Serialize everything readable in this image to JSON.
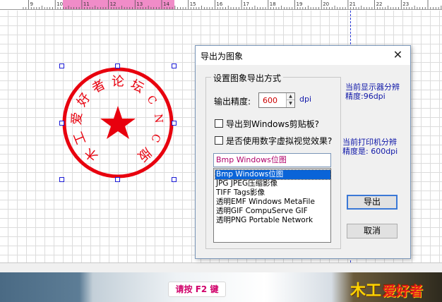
{
  "ruler": {
    "labels": [
      "9",
      "10",
      "11",
      "12",
      "13",
      "14",
      "15",
      "16",
      "17",
      "18",
      "19",
      "20",
      "21",
      "22",
      "23"
    ]
  },
  "seal": {
    "ring_text": "木工爱好者论坛CNC版",
    "color": "#e8000e"
  },
  "dialog": {
    "title": "导出为图象",
    "close_glyph": "✕",
    "group_legend": "设置图象导出方式",
    "precision_label": "输出精度:",
    "precision_value": "600",
    "precision_unit": "dpi",
    "clipboard_label": "导出到Windows剪贴板?",
    "digital_label": "是否使用数字虚拟视觉效果?",
    "format_selected": "Bmp Windows位图",
    "format_options": [
      "Bmp Windows位图",
      "JPG JPEG压缩影像",
      "TIFF Tags影像",
      "透明EMF Windows MetaFile",
      "透明GIF CompuServe GIF",
      "透明PNG Portable Network"
    ],
    "monitor_info": [
      "当前显示器分辨",
      "精度:96dpi"
    ],
    "printer_info": [
      "当前打印机分辨",
      "精度是: 600dpi"
    ],
    "export_button": "导出",
    "cancel_button": "取消"
  },
  "banner": {
    "hint": "请按 F2 键",
    "logo_mark": "木工",
    "logo_text": "爱好者"
  },
  "colors": {
    "accent": "#0a64d8",
    "ruler_selection": "#f08cc8",
    "info_text": "#0f17a8"
  }
}
